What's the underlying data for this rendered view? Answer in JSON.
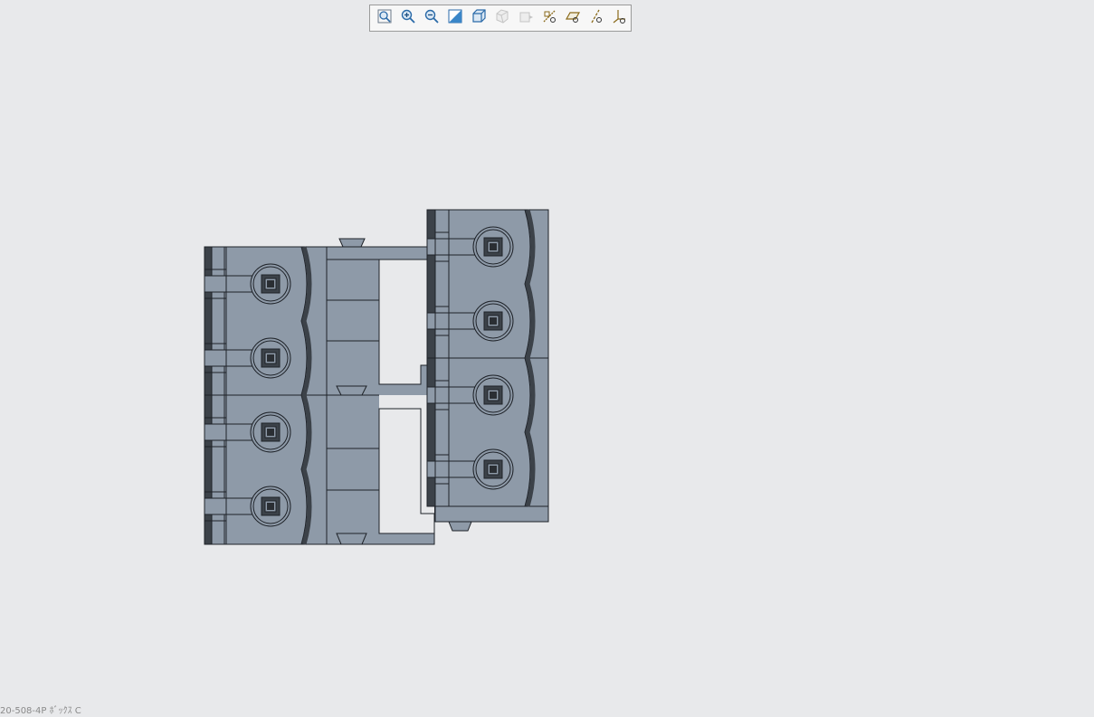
{
  "toolbar": {
    "buttons": [
      {
        "id": "refit",
        "icon": "refit-icon",
        "title": "Refit",
        "enabled": true
      },
      {
        "id": "zoom-in",
        "icon": "zoom-in-icon",
        "title": "Zoom In",
        "enabled": true
      },
      {
        "id": "zoom-out",
        "icon": "zoom-out-icon",
        "title": "Zoom Out",
        "enabled": true
      },
      {
        "id": "repaint",
        "icon": "repaint-icon",
        "title": "Repaint",
        "enabled": true
      },
      {
        "id": "display-style",
        "icon": "display-style-icon",
        "title": "Display Style",
        "enabled": true
      },
      {
        "id": "saved-views",
        "icon": "saved-views-icon",
        "title": "Saved Orientations",
        "enabled": false
      },
      {
        "id": "view-manager",
        "icon": "view-manager-icon",
        "title": "View Manager",
        "enabled": false
      },
      {
        "id": "datum-display",
        "icon": "datum-display-icon",
        "title": "Datum Display Filters",
        "enabled": true
      },
      {
        "id": "plane-display",
        "icon": "plane-display-icon",
        "title": "Plane Display",
        "enabled": true
      },
      {
        "id": "axis-display",
        "icon": "axis-display-icon",
        "title": "Axis Display",
        "enabled": true
      },
      {
        "id": "csys-display",
        "icon": "csys-display-icon",
        "title": "Coordinate System Display",
        "enabled": true
      }
    ]
  },
  "model": {
    "fill_color": "#8e9aa8",
    "edge_color": "#1e2228",
    "dark_color": "#3c4249",
    "highlight_color": "#b7c0cc"
  },
  "status": {
    "text": "20-508-4P  ﾎﾞｯｸｽ  C"
  }
}
